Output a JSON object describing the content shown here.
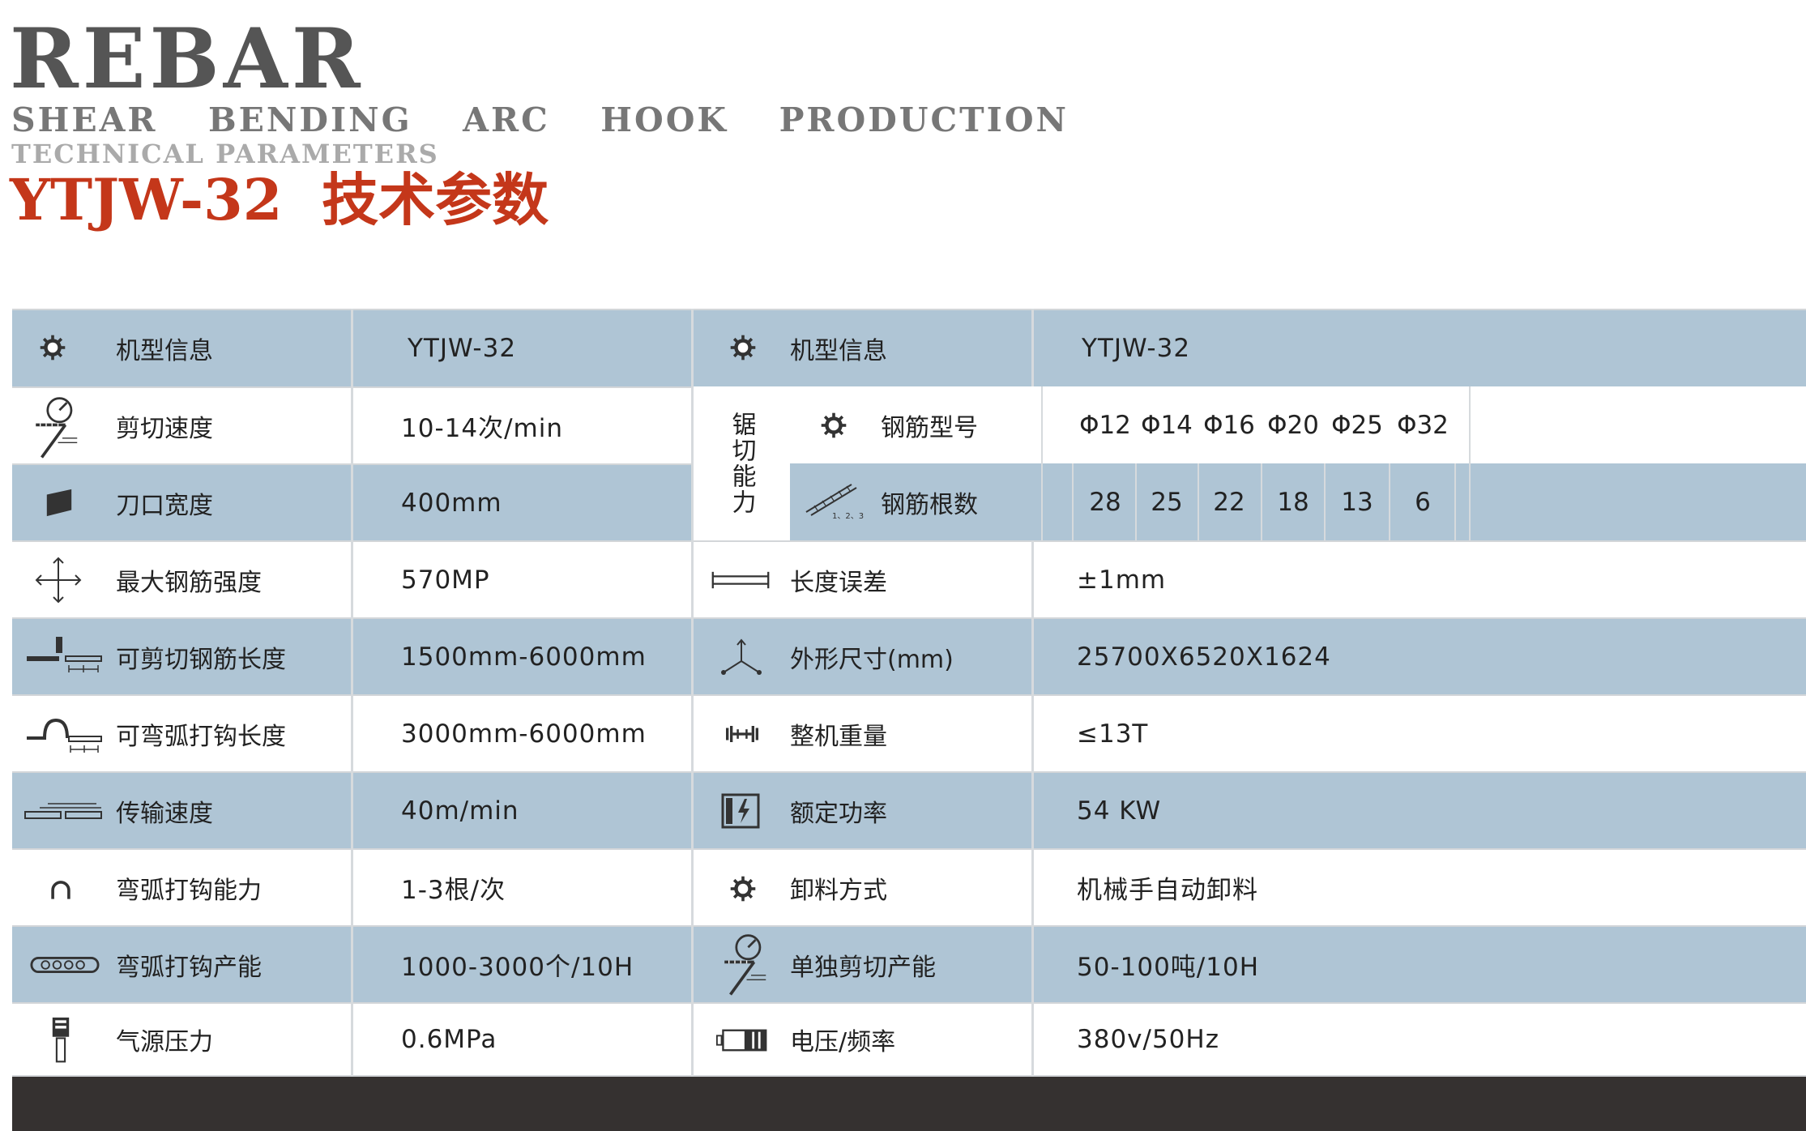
{
  "header": {
    "brand": "REBAR",
    "tagline": "SHEAR  BENDING  ARC  HOOK  PRODUCTION",
    "subtitle": "TECHNICAL PARAMETERS",
    "model_title": "YTJW-32  技术参数"
  },
  "colors": {
    "blue_row": "#afc5d5",
    "title_red": "#c4371a",
    "footer": "#353130"
  },
  "left_rows": [
    {
      "icon": "gear-icon",
      "label": "机型信息",
      "value": "YTJW-32"
    },
    {
      "icon": "speed-gauge-icon",
      "label": "剪切速度",
      "value": "10-14次/min"
    },
    {
      "icon": "blade-icon",
      "label": "刀口宽度",
      "value": "400mm"
    },
    {
      "icon": "arrows-cross-icon",
      "label": "最大钢筋强度",
      "value": "570MP"
    },
    {
      "icon": "shear-rebar-icon",
      "label": "可剪切钢筋长度",
      "value": "1500mm-6000mm"
    },
    {
      "icon": "arc-hook-rebar-icon",
      "label": "可弯弧打钩长度",
      "value": "3000mm-6000mm"
    },
    {
      "icon": "conveyor-icon",
      "label": "传输速度",
      "value": "40m/min"
    },
    {
      "icon": "hook-icon",
      "label": "弯弧打钩能力",
      "value": "1-3根/次"
    },
    {
      "icon": "chain-icon",
      "label": "弯弧打钩产能",
      "value": "1000-3000个/10H"
    },
    {
      "icon": "air-cylinder-icon",
      "label": "气源压力",
      "value": "0.6MPa"
    }
  ],
  "right_top": {
    "icon": "gear-icon",
    "label": "机型信息",
    "value": "YTJW-32"
  },
  "saw": {
    "label": "锯切能力",
    "type_label": "钢筋型号",
    "count_label": "钢筋根数",
    "count_icon_caption": "1、2、3",
    "types": [
      "Φ12",
      "Φ14",
      "Φ16",
      "Φ20",
      "Φ25",
      "Φ32"
    ],
    "counts": [
      "28",
      "25",
      "22",
      "18",
      "13",
      "6"
    ]
  },
  "right_rows": [
    {
      "icon": "ruler-icon",
      "label": "长度误差",
      "value": "±1mm"
    },
    {
      "icon": "axes-3d-icon",
      "label": "外形尺寸(mm)",
      "value": "25700X6520X1624"
    },
    {
      "icon": "weight-icon",
      "label": "整机重量",
      "value": "≤13T"
    },
    {
      "icon": "power-icon",
      "label": "额定功率",
      "value": "54 KW"
    },
    {
      "icon": "gear-icon",
      "label": "卸料方式",
      "value": "机械手自动卸料"
    },
    {
      "icon": "speed-gauge-icon",
      "label": "单独剪切产能",
      "value": "50-100吨/10H"
    },
    {
      "icon": "battery-icon",
      "label": "电压/频率",
      "value": "380v/50Hz"
    }
  ]
}
